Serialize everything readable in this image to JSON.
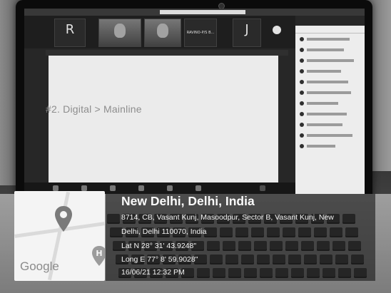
{
  "scene": {
    "meeting_tiles": [
      {
        "letter": "R",
        "caption": "",
        "video": false
      },
      {
        "letter": "",
        "caption": "",
        "video": true
      },
      {
        "letter": "",
        "caption": "",
        "video": true
      },
      {
        "letter": "",
        "caption": "RAVINO-P/S B...",
        "video": false
      },
      {
        "letter": "J",
        "caption": "",
        "video": false
      }
    ],
    "slide_text": "#2. Digital > Mainline"
  },
  "geotag": {
    "map_logo": "Google",
    "location_title": "New Delhi, Delhi, India",
    "address_line1": "8714, CB, Vasant Kunj, Masoodpur, Sector B, Vasant Kunj, New",
    "address_line2": "Delhi, Delhi 110070, India",
    "latitude": "Lat N 28° 31' 43.9248\"",
    "longitude": "Long E 77° 8' 59.9028\"",
    "datetime": "16/06/21 12:32 PM"
  }
}
